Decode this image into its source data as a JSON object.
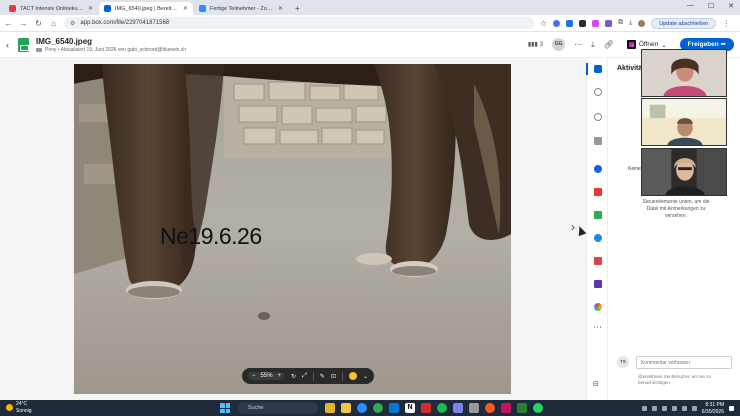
{
  "browser": {
    "tabs": [
      {
        "title": "TACT Intensiv Onlinekurs V1",
        "color": "#e03b3b",
        "active": false
      },
      {
        "title": "IMG_6540.jpeg | Bereitgestellt",
        "color": "#0061d5",
        "active": true
      },
      {
        "title": "Fertige Teilnehmer - Zoom",
        "color": "#2d8cff",
        "active": false
      }
    ],
    "new_tab": "+",
    "url": "app.box.com/file/2297041871568",
    "update_label": "Update abschließen"
  },
  "file": {
    "name": "IMG_6540.jpeg",
    "meta": "Pony • Aktualisiert 19. Juni 2026 von gabi_schroed@bluewin.ch",
    "view_count": "3",
    "avatar_initials": "GG",
    "open_label": "Öffnen",
    "share_label": "Freigeben"
  },
  "preview": {
    "caption": "Ne19.6.26",
    "zoom_level": "55%",
    "zoom_minus": "−",
    "zoom_plus": "+"
  },
  "activity": {
    "title": "Aktivitä",
    "empty_prefix": "Keine",
    "hint": "Steuerelemente unten, um die Datei mit Anmerkungen zu versehen.",
    "commenter_initials": "TS",
    "comment_placeholder": "Kommentar verfassen",
    "comment_hint": "@erwähnen Sie Benutzer, um sie zu benachrichtigen."
  },
  "taskbar": {
    "temperature": "24°C",
    "condition": "Sonnig",
    "search_placeholder": "Suche",
    "time": "8:31 PM",
    "date": "6/30/2026"
  },
  "colors": {
    "accent": "#0061d5",
    "taskbar": "#1f2a3a"
  }
}
